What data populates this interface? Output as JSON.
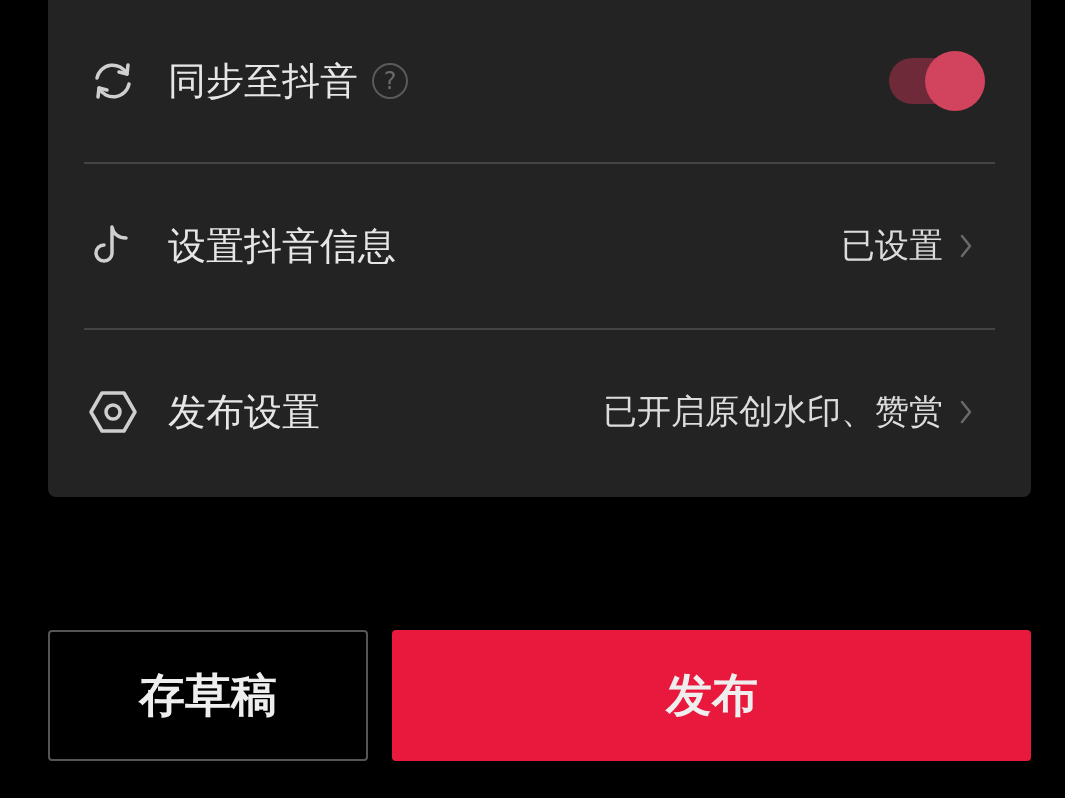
{
  "settings": [
    {
      "kind": "toggle",
      "label": "同步至抖音",
      "help_mark": "?",
      "on": true
    },
    {
      "kind": "link",
      "label": "设置抖音信息",
      "value": "已设置"
    },
    {
      "kind": "link",
      "label": "发布设置",
      "value": "已开启原创水印、赞赏"
    }
  ],
  "buttons": [
    {
      "kind": "secondary",
      "label": "存草稿"
    },
    {
      "kind": "primary",
      "label": "发布"
    }
  ]
}
